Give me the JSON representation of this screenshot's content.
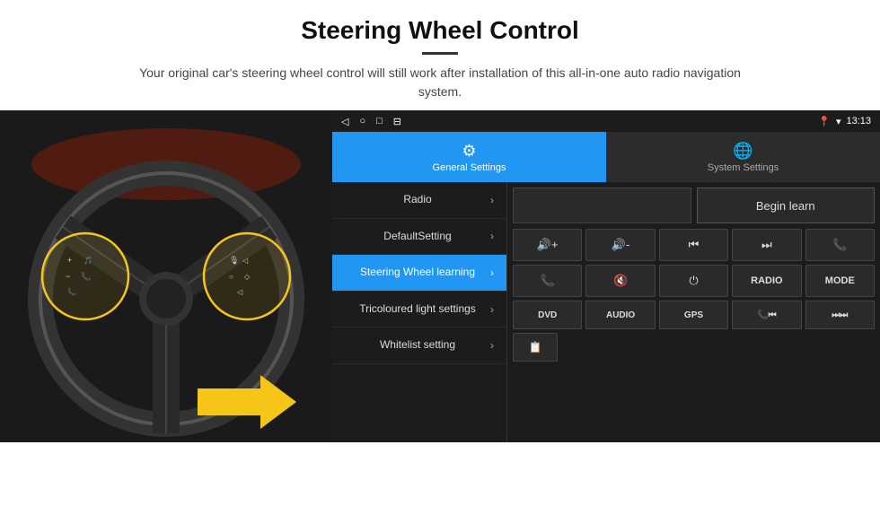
{
  "header": {
    "title": "Steering Wheel Control",
    "subtitle": "Your original car's steering wheel control will still work after installation of this all-in-one auto radio navigation system."
  },
  "tabs": [
    {
      "label": "General Settings",
      "active": true,
      "icon": "⚙"
    },
    {
      "label": "System Settings",
      "active": false,
      "icon": "🌐"
    }
  ],
  "status_bar": {
    "time": "13:13",
    "icons_left": [
      "◁",
      "○",
      "□",
      "⊟"
    ],
    "icons_right": [
      "📍",
      "▼",
      "13:13"
    ]
  },
  "menu_items": [
    {
      "label": "Radio",
      "active": false
    },
    {
      "label": "DefaultSetting",
      "active": false
    },
    {
      "label": "Steering Wheel learning",
      "active": true
    },
    {
      "label": "Tricoloured light settings",
      "active": false
    },
    {
      "label": "Whitelist setting",
      "active": false
    }
  ],
  "control_buttons": {
    "begin_learn": "Begin learn",
    "row1": [
      "🔊+",
      "🔊-",
      "⏮",
      "⏭",
      "📞"
    ],
    "row2": [
      "📞",
      "🔇",
      "⏻",
      "RADIO",
      "MODE"
    ],
    "row3_labels": [
      "DVD",
      "AUDIO",
      "GPS",
      "📞⏮",
      "⏭⏭"
    ],
    "last_icon": "📋"
  }
}
